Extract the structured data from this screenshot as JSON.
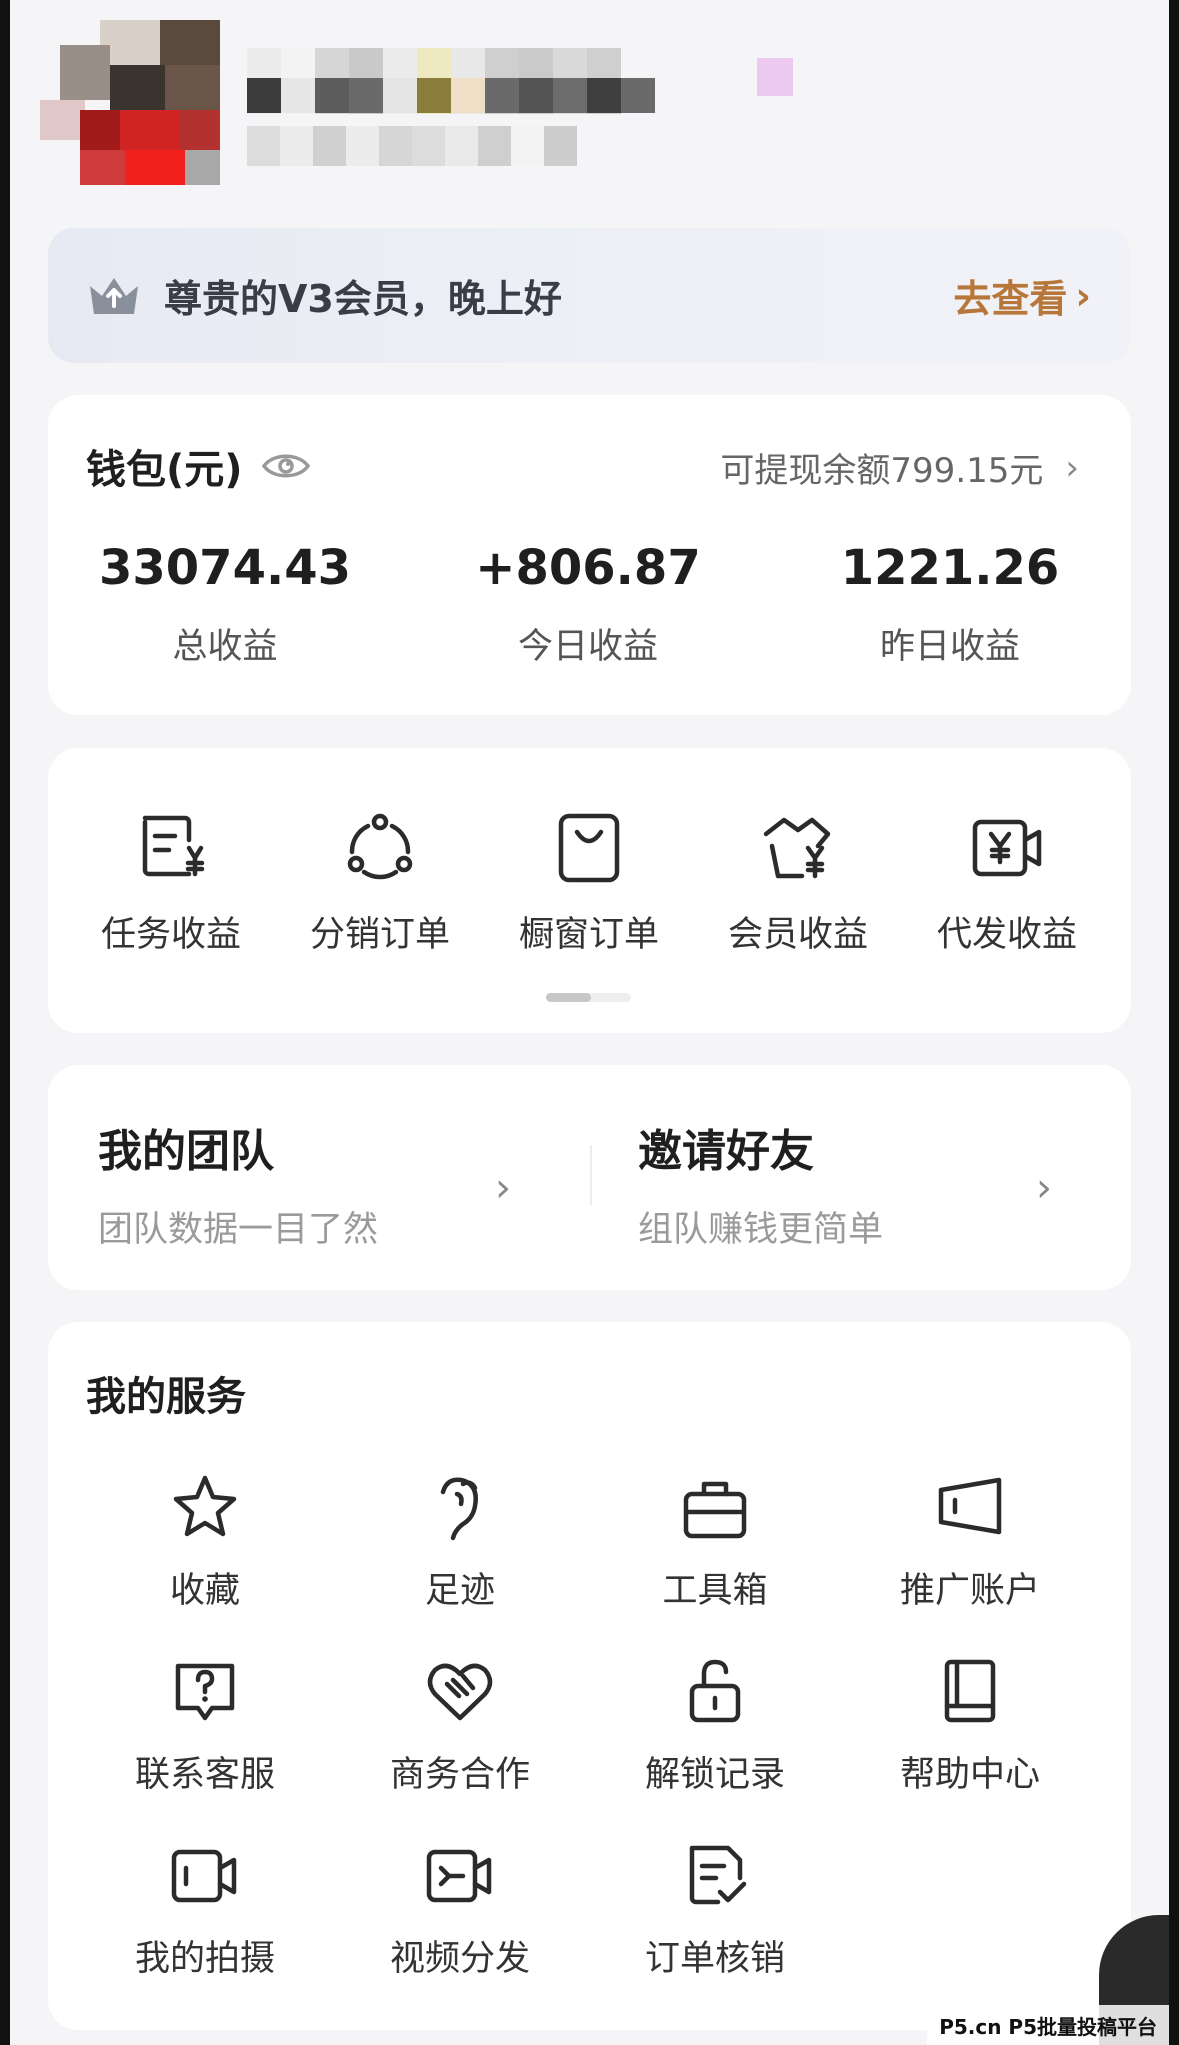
{
  "vip_banner": {
    "greeting": "尊贵的V3会员，晚上好",
    "action": "去查看",
    "chevron": "›"
  },
  "wallet": {
    "title": "钱包(元)",
    "withdrawable": "可提现余额799.15元",
    "chevron": "›",
    "stats": [
      {
        "value": "33074.43",
        "label": "总收益"
      },
      {
        "value": "+806.87",
        "label": "今日收益"
      },
      {
        "value": "1221.26",
        "label": "昨日收益"
      }
    ]
  },
  "actions": [
    {
      "label": "任务收益",
      "icon": "task-income-icon"
    },
    {
      "label": "分销订单",
      "icon": "distribution-icon"
    },
    {
      "label": "橱窗订单",
      "icon": "shopping-bag-icon"
    },
    {
      "label": "会员收益",
      "icon": "member-income-icon"
    },
    {
      "label": "代发收益",
      "icon": "video-income-icon"
    }
  ],
  "team": {
    "left": {
      "title": "我的团队",
      "subtitle": "团队数据一目了然"
    },
    "right": {
      "title": "邀请好友",
      "subtitle": "组队赚钱更简单"
    },
    "chevron": "›"
  },
  "services": {
    "title": "我的服务",
    "items": [
      {
        "label": "收藏",
        "icon": "star-icon"
      },
      {
        "label": "足迹",
        "icon": "footprint-icon"
      },
      {
        "label": "工具箱",
        "icon": "toolbox-icon"
      },
      {
        "label": "推广账户",
        "icon": "promotion-account-icon"
      },
      {
        "label": "联系客服",
        "icon": "customer-service-icon"
      },
      {
        "label": "商务合作",
        "icon": "handshake-heart-icon"
      },
      {
        "label": "解锁记录",
        "icon": "unlock-icon"
      },
      {
        "label": "帮助中心",
        "icon": "book-icon"
      },
      {
        "label": "我的拍摄",
        "icon": "camera-icon"
      },
      {
        "label": "视频分发",
        "icon": "video-share-icon"
      },
      {
        "label": "订单核销",
        "icon": "order-verify-icon"
      }
    ]
  },
  "watermark": "P5.cn P5批量投稿平台",
  "colors": {
    "accent_gold": "#b8773a",
    "background": "#f5f5f7",
    "card": "#ffffff"
  }
}
